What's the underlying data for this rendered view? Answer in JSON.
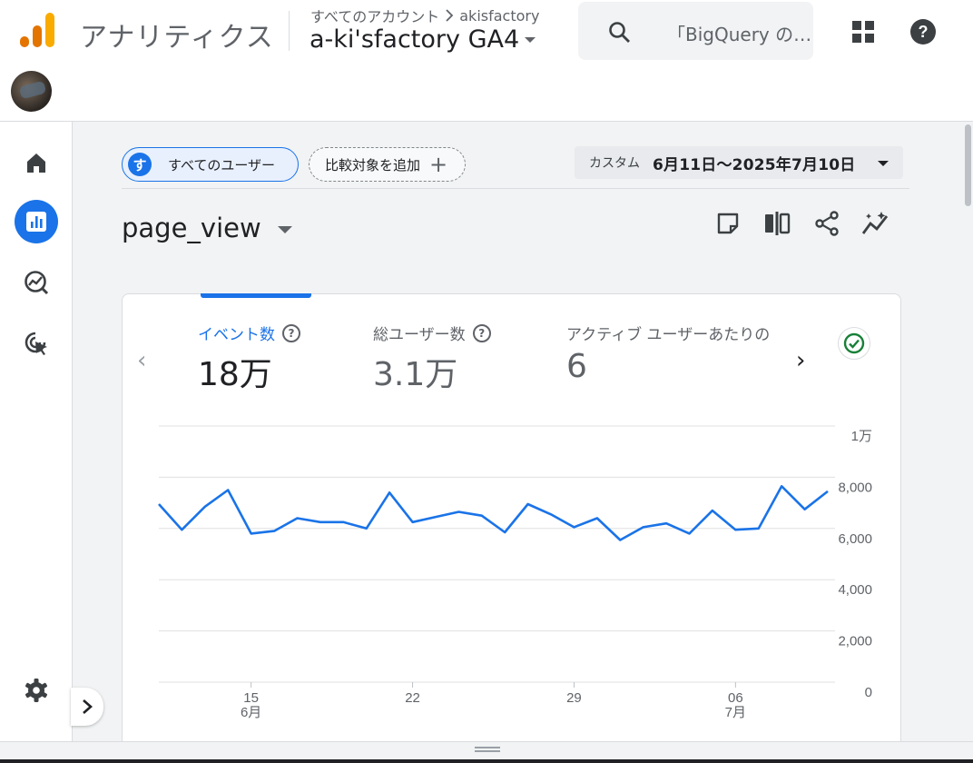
{
  "header": {
    "app_title": "アナリティクス",
    "breadcrumb_account": "すべてのアカウント",
    "breadcrumb_property": "akisfactory",
    "property_name": "a-ki'sfactory GA4",
    "search_placeholder": "「BigQuery の…"
  },
  "rail": {
    "items": [
      "home-icon",
      "reports-icon",
      "explore-icon",
      "advertising-icon"
    ],
    "settings": "gear-icon"
  },
  "toolbar": {
    "segment_badge": "す",
    "segment_label": "すべてのユーザー",
    "compare_label": "比較対象を追加",
    "compare_plus": "+",
    "date_custom": "カスタム",
    "date_range": "6月11日～2025年7月10日"
  },
  "page": {
    "title": "page_view"
  },
  "metrics": [
    {
      "label": "イベント数",
      "value": "18万",
      "active": true
    },
    {
      "label": "総ユーザー数",
      "value": "3.1万",
      "active": false
    },
    {
      "label": "アクティブ ユーザーあたりの",
      "value": "6",
      "active": false
    }
  ],
  "nav": {
    "prev": "‹",
    "next": "›"
  },
  "colors": {
    "accent": "#1a73e8",
    "line": "#1a73e8",
    "check": "#188038"
  },
  "chart_data": {
    "type": "line",
    "x_start": "2025-06-11",
    "x_end": "2025-07-10",
    "x_ticks": [
      {
        "day": "15",
        "month": "6月",
        "index": 4
      },
      {
        "day": "22",
        "month": "",
        "index": 11
      },
      {
        "day": "29",
        "month": "",
        "index": 18
      },
      {
        "day": "06",
        "month": "7月",
        "index": 25
      }
    ],
    "y_ticks": [
      "0",
      "2,000",
      "4,000",
      "6,000",
      "8,000",
      "1万"
    ],
    "ylim": [
      0,
      10000
    ],
    "series": [
      {
        "values": [
          6950,
          5950,
          6850,
          7500,
          5800,
          5900,
          6400,
          6250,
          6250,
          6000,
          7400,
          6250,
          6450,
          6650,
          6500,
          5850,
          6950,
          6550,
          6050,
          6400,
          5550,
          6050,
          6200,
          5800,
          6700,
          5950,
          6000,
          7650,
          6750,
          7450
        ]
      }
    ]
  }
}
